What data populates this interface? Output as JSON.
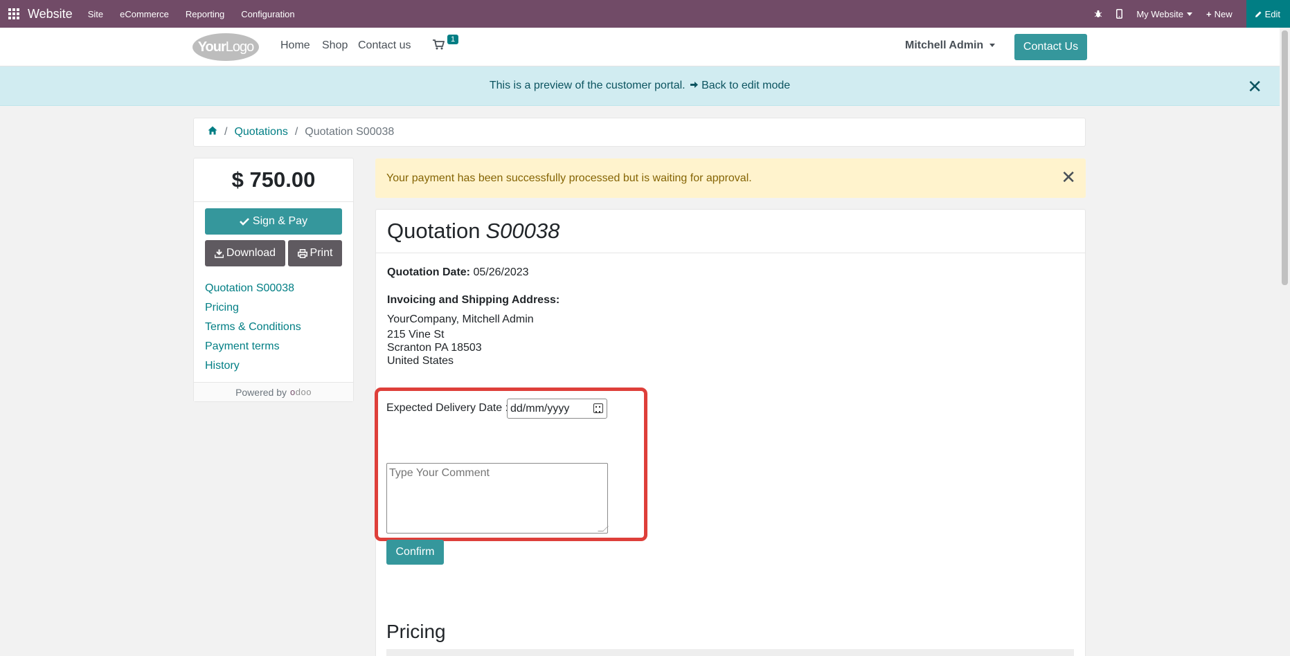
{
  "topbar": {
    "app_name": "Website",
    "menus": [
      "Site",
      "eCommerce",
      "Reporting",
      "Configuration"
    ],
    "website_selector": "My Website",
    "new_label": "New",
    "edit_label": "Edit"
  },
  "header": {
    "logo_text_bold": "Your",
    "logo_text_light": "Logo",
    "nav": [
      "Home",
      "Shop",
      "Contact us"
    ],
    "cart_count": "1",
    "user_name": "Mitchell Admin",
    "contact_button": "Contact Us"
  },
  "banner": {
    "text": "This is a preview of the customer portal.",
    "link": "Back to edit mode"
  },
  "breadcrumb": {
    "quotations": "Quotations",
    "current": "Quotation S00038"
  },
  "sidebar": {
    "amount": "$ 750.00",
    "sign_pay": "Sign & Pay",
    "download": "Download",
    "print": "Print",
    "links": [
      "Quotation S00038",
      "Pricing",
      "Terms & Conditions",
      "Payment terms",
      "History"
    ],
    "powered_by": "Powered by",
    "odoo_o": "o",
    "odoo_rest": "doo"
  },
  "alert": {
    "text": "Your payment has been successfully processed but is waiting for approval."
  },
  "quotation": {
    "title_prefix": "Quotation",
    "title_ref": "S00038",
    "date_label": "Quotation Date:",
    "date_value": "05/26/2023",
    "address_label": "Invoicing and Shipping Address:",
    "address_lines": [
      "YourCompany, Mitchell Admin",
      "215 Vine St",
      "Scranton PA 18503",
      "United States"
    ],
    "delivery_label": "Expected Delivery Date :",
    "delivery_placeholder": "dd/mm/yyyy",
    "comment_placeholder": "Type Your Comment",
    "confirm_label": "Confirm",
    "pricing_heading": "Pricing"
  },
  "colors": {
    "topbar": "#714b67",
    "accent": "#017e84",
    "button_primary": "#35979c",
    "highlight": "#de3f3a"
  }
}
